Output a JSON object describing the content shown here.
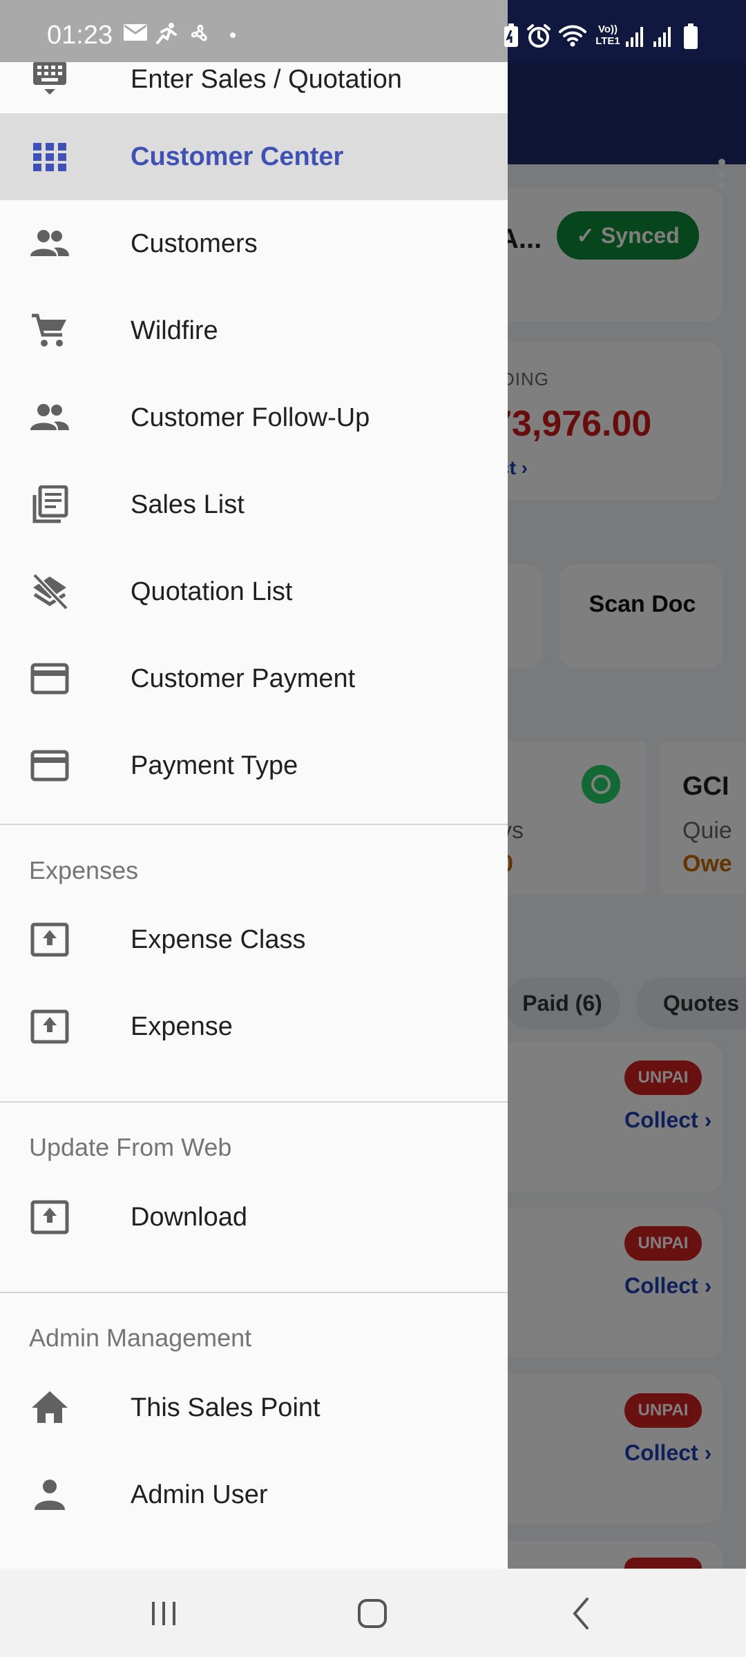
{
  "status_bar": {
    "time": "01:23",
    "icons": [
      "mail-icon",
      "activity-icon",
      "fan-icon",
      "dot-icon",
      "battery-saver-icon",
      "alarm-icon",
      "wifi-icon",
      "volte-lte-icon",
      "signal-icon",
      "signal-icon",
      "battery-icon"
    ],
    "volte_label": "Vo))",
    "lte_label": "LTE1"
  },
  "drawer": {
    "top_item": {
      "label": "Enter Sales / Quotation",
      "icon": "keyboard-icon"
    },
    "items": [
      {
        "label": "Customer Center",
        "icon": "grid-icon",
        "active": true
      },
      {
        "label": "Customers",
        "icon": "people-icon"
      },
      {
        "label": "Wildfire",
        "icon": "cart-icon"
      },
      {
        "label": "Customer Follow-Up",
        "icon": "people-icon"
      },
      {
        "label": "Sales List",
        "icon": "list-icon"
      },
      {
        "label": "Quotation List",
        "icon": "layers-off-icon"
      },
      {
        "label": "Customer Payment",
        "icon": "card-icon"
      },
      {
        "label": "Payment Type",
        "icon": "card-icon"
      }
    ],
    "sections": [
      {
        "header": "Expenses",
        "items": [
          {
            "label": "Expense Class",
            "icon": "upload-box-icon"
          },
          {
            "label": "Expense",
            "icon": "upload-box-icon"
          }
        ]
      },
      {
        "header": "Update From Web",
        "items": [
          {
            "label": "Download",
            "icon": "upload-box-icon"
          }
        ]
      },
      {
        "header": "Admin Management",
        "items": [
          {
            "label": "This Sales Point",
            "icon": "home-icon"
          },
          {
            "label": "Admin User",
            "icon": "person-icon"
          }
        ]
      }
    ]
  },
  "background": {
    "abbr": "A...",
    "synced": "✓ Synced",
    "pending_label": "DING",
    "pending_amount": "73,976.00",
    "collect_link": "ct ›",
    "scan_doc": "Scan Doc",
    "days": "ys",
    "zero": "0",
    "gci": "GCI",
    "quie": "Quie",
    "owe": "Owe",
    "tab_paid": "Paid (6)",
    "tab_quotes": "Quotes",
    "unpaid": "UNPAI",
    "collect": "Collect ›"
  },
  "nav_bar": {
    "buttons": [
      "recent-apps-icon",
      "home-button-icon",
      "back-icon"
    ]
  }
}
